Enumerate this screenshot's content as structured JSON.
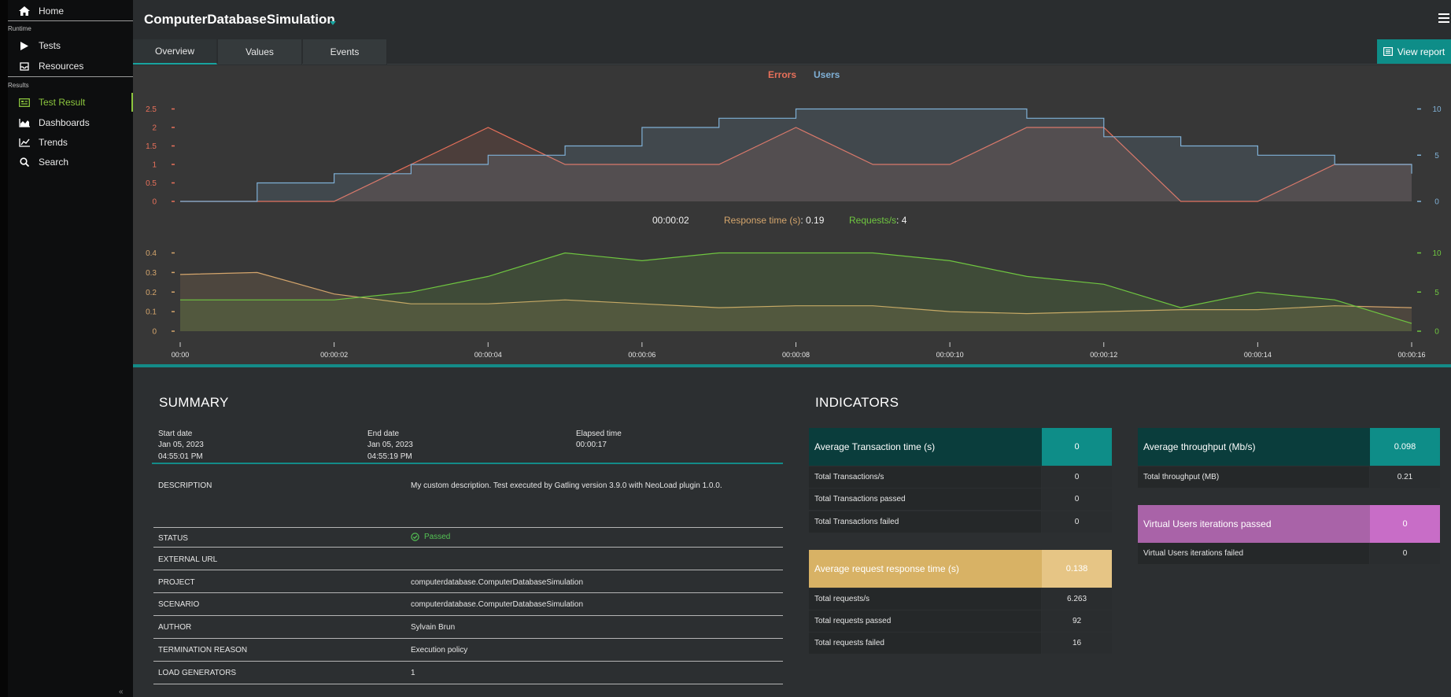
{
  "sidebar": {
    "home": "Home",
    "runtime_section": "Runtime",
    "tests": "Tests",
    "resources": "Resources",
    "results_section": "Results",
    "test_result": "Test Result",
    "dashboards": "Dashboards",
    "trends": "Trends",
    "search": "Search",
    "collapse": "«"
  },
  "header": {
    "title": "ComputerDatabaseSimulation"
  },
  "tabs": [
    "Overview",
    "Values",
    "Events"
  ],
  "view_report": "View report",
  "colors": {
    "errors": "#e8705a",
    "users": "#7fb0d6",
    "response_time": "#d4a56c",
    "requests": "#6fc640",
    "teal": "#138b88"
  },
  "chart_data": [
    {
      "type": "line",
      "legend": [
        "Errors",
        "Users"
      ],
      "x": [
        "00:00",
        "00:00:01",
        "00:00:02",
        "00:00:03",
        "00:00:04",
        "00:00:05",
        "00:00:06",
        "00:00:07",
        "00:00:08",
        "00:00:09",
        "00:00:10",
        "00:00:11",
        "00:00:12",
        "00:00:13",
        "00:00:14",
        "00:00:15",
        "00:00:16"
      ],
      "series": [
        {
          "name": "Errors",
          "axis": "left",
          "step": false,
          "values": [
            0,
            0,
            0,
            1,
            2,
            1,
            1,
            1,
            2,
            1,
            1,
            2,
            2,
            0,
            0,
            1,
            1
          ]
        },
        {
          "name": "Users",
          "axis": "right",
          "step": true,
          "values": [
            0,
            2,
            3,
            4,
            5,
            6,
            8,
            9,
            10,
            10,
            10,
            9,
            7,
            6,
            5,
            4,
            3
          ]
        }
      ],
      "left_ticks": [
        "0",
        "0.5",
        "1",
        "1.5",
        "2",
        "2.5"
      ],
      "left_ylim": [
        0,
        2.5
      ],
      "right_ticks": [
        "0",
        "5",
        "10"
      ],
      "right_ylim": [
        0,
        10
      ]
    },
    {
      "type": "area",
      "legend": [
        "Response time (s)",
        "Requests/s"
      ],
      "x": [
        "00:00",
        "00:00:01",
        "00:00:02",
        "00:00:03",
        "00:00:04",
        "00:00:05",
        "00:00:06",
        "00:00:07",
        "00:00:08",
        "00:00:09",
        "00:00:10",
        "00:00:11",
        "00:00:12",
        "00:00:13",
        "00:00:14",
        "00:00:15",
        "00:00:16"
      ],
      "x_tick_labels": [
        "00:00",
        "00:00:02",
        "00:00:04",
        "00:00:06",
        "00:00:08",
        "00:00:10",
        "00:00:12",
        "00:00:14",
        "00:00:16"
      ],
      "series": [
        {
          "name": "Response time (s)",
          "axis": "left",
          "values": [
            0.29,
            0.3,
            0.19,
            0.14,
            0.14,
            0.16,
            0.14,
            0.12,
            0.13,
            0.13,
            0.1,
            0.09,
            0.1,
            0.11,
            0.11,
            0.13,
            0.12
          ]
        },
        {
          "name": "Requests/s",
          "axis": "right",
          "values": [
            4,
            4,
            4,
            5,
            7,
            10,
            9,
            10,
            10,
            10,
            9,
            7,
            6,
            3,
            5,
            4,
            1
          ]
        }
      ],
      "left_ticks": [
        "0",
        "0.1",
        "0.2",
        "0.3",
        "0.4"
      ],
      "left_ylim": [
        0,
        0.4
      ],
      "right_ticks": [
        "0",
        "5",
        "10"
      ],
      "right_ylim": [
        0,
        10
      ]
    }
  ],
  "readout": {
    "time": "00:00:02",
    "response_label": "Response time (s)",
    "response_value": "0.19",
    "requests_label": "Requests/s",
    "requests_value": "4"
  },
  "summary": {
    "title": "SUMMARY",
    "start_label": "Start date",
    "start_date": "Jan 05, 2023",
    "start_time": "04:55:01 PM",
    "end_label": "End date",
    "end_date": "Jan 05, 2023",
    "end_time": "04:55:19 PM",
    "elapsed_label": "Elapsed time",
    "elapsed_value": "00:00:17",
    "rows": [
      {
        "label": "DESCRIPTION",
        "value": "My custom description. Test executed by Gatling version 3.9.0 with NeoLoad plugin 1.0.0."
      },
      {
        "label": "STATUS",
        "value": "Passed"
      },
      {
        "label": "EXTERNAL URL",
        "value": ""
      },
      {
        "label": "PROJECT",
        "value": "computerdatabase.ComputerDatabaseSimulation"
      },
      {
        "label": "SCENARIO",
        "value": "computerdatabase.ComputerDatabaseSimulation"
      },
      {
        "label": "AUTHOR",
        "value": "Sylvain Brun"
      },
      {
        "label": "TERMINATION REASON",
        "value": "Execution policy"
      },
      {
        "label": "LOAD GENERATORS",
        "value": "1"
      }
    ]
  },
  "indicators": {
    "title": "INDICATORS",
    "transactions": {
      "header": "Average Transaction time (s)",
      "value": "0",
      "rows": [
        {
          "label": "Total Transactions/s",
          "value": "0"
        },
        {
          "label": "Total Transactions passed",
          "value": "0"
        },
        {
          "label": "Total Transactions failed",
          "value": "0"
        }
      ]
    },
    "requests": {
      "header": "Average request response time (s)",
      "value": "0.138",
      "rows": [
        {
          "label": "Total requests/s",
          "value": "6.263"
        },
        {
          "label": "Total requests passed",
          "value": "92"
        },
        {
          "label": "Total requests failed",
          "value": "16"
        }
      ]
    },
    "throughput": {
      "header": "Average throughput (Mb/s)",
      "value": "0.098",
      "rows": [
        {
          "label": "Total throughput (MB)",
          "value": "0.21"
        }
      ]
    },
    "iterations": {
      "header": "Virtual Users iterations passed",
      "value": "0",
      "rows": [
        {
          "label": "Virtual Users iterations failed",
          "value": "0"
        }
      ]
    }
  }
}
